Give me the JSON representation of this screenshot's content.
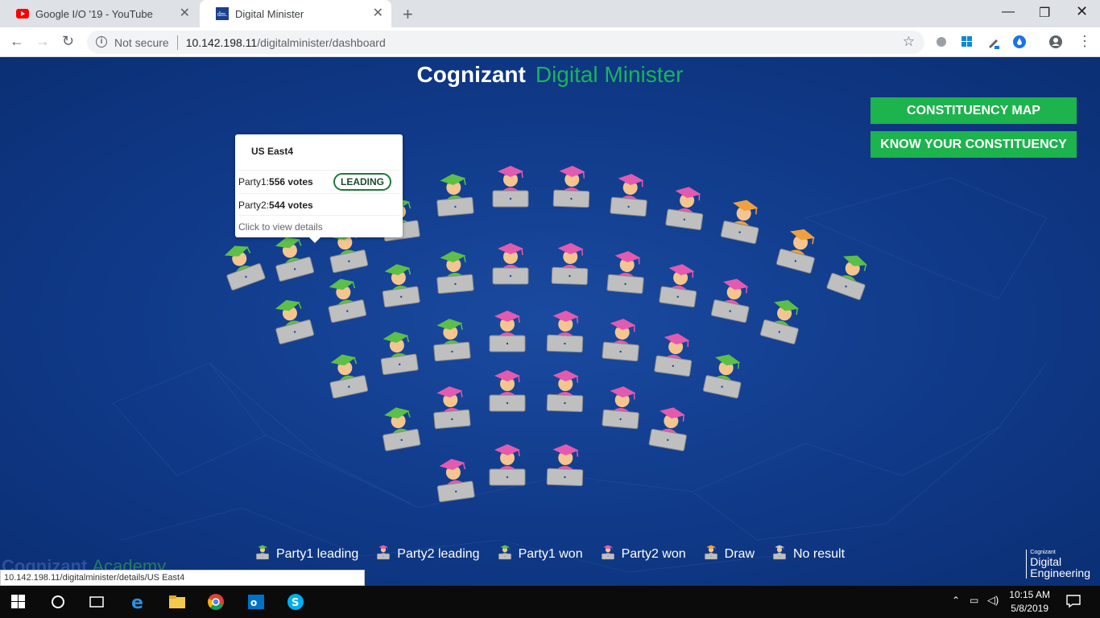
{
  "browser": {
    "tabs": [
      {
        "title": "Google I/O '19 - YouTube"
      },
      {
        "title": "Digital Minister"
      }
    ],
    "security_label": "Not secure",
    "url_host": "10.142.198.11",
    "url_path": "/digitalminister/dashboard",
    "favicon_dm": "dm."
  },
  "header": {
    "brand": "Cognizant",
    "product": "Digital Minister"
  },
  "buttons": {
    "constituency_map": "CONSTITUENCY MAP",
    "know_constituency": "KNOW YOUR CONSTITUENCY"
  },
  "tooltip": {
    "title": "US East4",
    "party1_label": "Party1: ",
    "party1_votes": "556 votes",
    "leading_badge": "LEADING",
    "party2_label": "Party2: ",
    "party2_votes": "544 votes",
    "hint": "Click to view details"
  },
  "colors": {
    "party1": "#5cbf4a",
    "party2": "#e25bb0",
    "draw": "#f0a040",
    "no_result": "#c8c8c8",
    "accent_button": "#1db34d"
  },
  "seats": [
    "party1",
    "party1",
    "party1",
    "party1",
    "party1",
    "party2",
    "party2",
    "party2",
    "party2",
    "draw",
    "draw",
    "party1",
    "party1",
    "party1",
    "party1",
    "party1",
    "party2",
    "party2",
    "party2",
    "party2",
    "party2",
    "party1",
    "party1",
    "party1",
    "party1",
    "party2",
    "party2",
    "party2",
    "party2",
    "party1",
    "party1",
    "party2",
    "party2",
    "party2",
    "party2",
    "party2",
    "party2",
    "party2",
    "party2"
  ],
  "legend": [
    {
      "label": "Party1 leading",
      "status": "party1"
    },
    {
      "label": "Party2 leading",
      "status": "party2"
    },
    {
      "label": "Party1 won",
      "status": "party1"
    },
    {
      "label": "Party2 won",
      "status": "party2"
    },
    {
      "label": "Draw",
      "status": "draw"
    },
    {
      "label": "No result",
      "status": "no_result"
    }
  ],
  "footer": {
    "academy_a": "Cognizant",
    "academy_b": "Academy",
    "de_small": "Cognizant",
    "de_line1": "Digital",
    "de_line2": "Engineering"
  },
  "status_bar_url": "10.142.198.11/digitalminister/details/US East4",
  "taskbar": {
    "time": "10:15 AM",
    "date": "5/8/2019"
  }
}
